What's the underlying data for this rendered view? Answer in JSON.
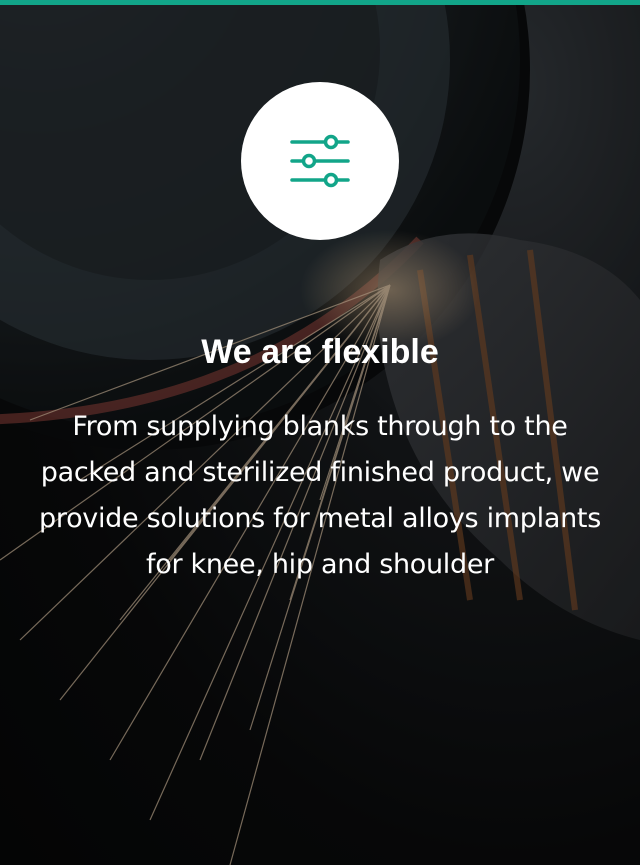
{
  "card": {
    "icon": "sliders-icon",
    "title": "We are flexible",
    "description": "From supplying blanks through to the packed and sterilized finished product, we provide solutions for metal alloys implants for knee, hip and shoulder"
  },
  "colors": {
    "accent": "#12a589",
    "icon_background": "#ffffff",
    "text": "#ffffff"
  }
}
